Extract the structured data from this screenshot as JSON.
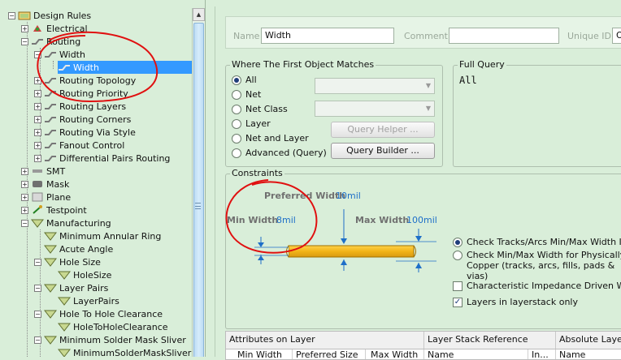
{
  "tree": {
    "items": [
      {
        "label": "Design Rules"
      },
      {
        "label": "Electrical"
      },
      {
        "label": "Routing"
      },
      {
        "label": "Width"
      },
      {
        "label": "Width"
      },
      {
        "label": "Routing Topology"
      },
      {
        "label": "Routing Priority"
      },
      {
        "label": "Routing Layers"
      },
      {
        "label": "Routing Corners"
      },
      {
        "label": "Routing Via Style"
      },
      {
        "label": "Fanout Control"
      },
      {
        "label": "Differential Pairs Routing"
      },
      {
        "label": "SMT"
      },
      {
        "label": "Mask"
      },
      {
        "label": "Plane"
      },
      {
        "label": "Testpoint"
      },
      {
        "label": "Manufacturing"
      },
      {
        "label": "Minimum Annular Ring"
      },
      {
        "label": "Acute Angle"
      },
      {
        "label": "Hole Size"
      },
      {
        "label": "HoleSize"
      },
      {
        "label": "Layer Pairs"
      },
      {
        "label": "LayerPairs"
      },
      {
        "label": "Hole To Hole Clearance"
      },
      {
        "label": "HoleToHoleClearance"
      },
      {
        "label": "Minimum Solder Mask Sliver"
      },
      {
        "label": "MinimumSolderMaskSliver"
      }
    ]
  },
  "header": {
    "name_label": "Name",
    "name_value": "Width",
    "comment_label": "Comment",
    "comment_value": "",
    "uid_label": "Unique ID",
    "uid_value": "O"
  },
  "match": {
    "title": "Where The First Object Matches",
    "options": [
      "All",
      "Net",
      "Net Class",
      "Layer",
      "Net and Layer",
      "Advanced (Query)"
    ],
    "selected": "All",
    "query_helper_label": "Query Helper ...",
    "query_builder_label": "Query Builder ..."
  },
  "full_query": {
    "title": "Full Query",
    "text": "All"
  },
  "constraints": {
    "title": "Constraints",
    "preferred_label": "Preferred Width",
    "preferred_value": "10mil",
    "min_label": "Min Width",
    "min_value": "8mil",
    "max_label": "Max Width",
    "max_value": "100mil",
    "radio1": "Check Tracks/Arcs Min/Max Width Ind",
    "radio2_line1": "Check Min/Max Width for Physically C",
    "radio2_line2": "Copper (tracks, arcs, fills, pads & vias)",
    "check1": "Characteristic Impedance Driven Widt",
    "check1_checked": false,
    "check2": "Layers in layerstack only",
    "check2_checked": true
  },
  "table": {
    "group_headers": [
      "Attributes on Layer",
      "Layer Stack Reference",
      "Absolute Layer"
    ],
    "sub_headers": [
      "Min Width",
      "Preferred Size",
      "Max Width",
      "Name",
      "In...",
      "Name"
    ]
  },
  "colors": {
    "background": "#d9eed9",
    "selection": "#3399ff",
    "value_blue": "#1e6fc8",
    "track_fill": "#f2b418",
    "annotation_red": "#e01010"
  }
}
